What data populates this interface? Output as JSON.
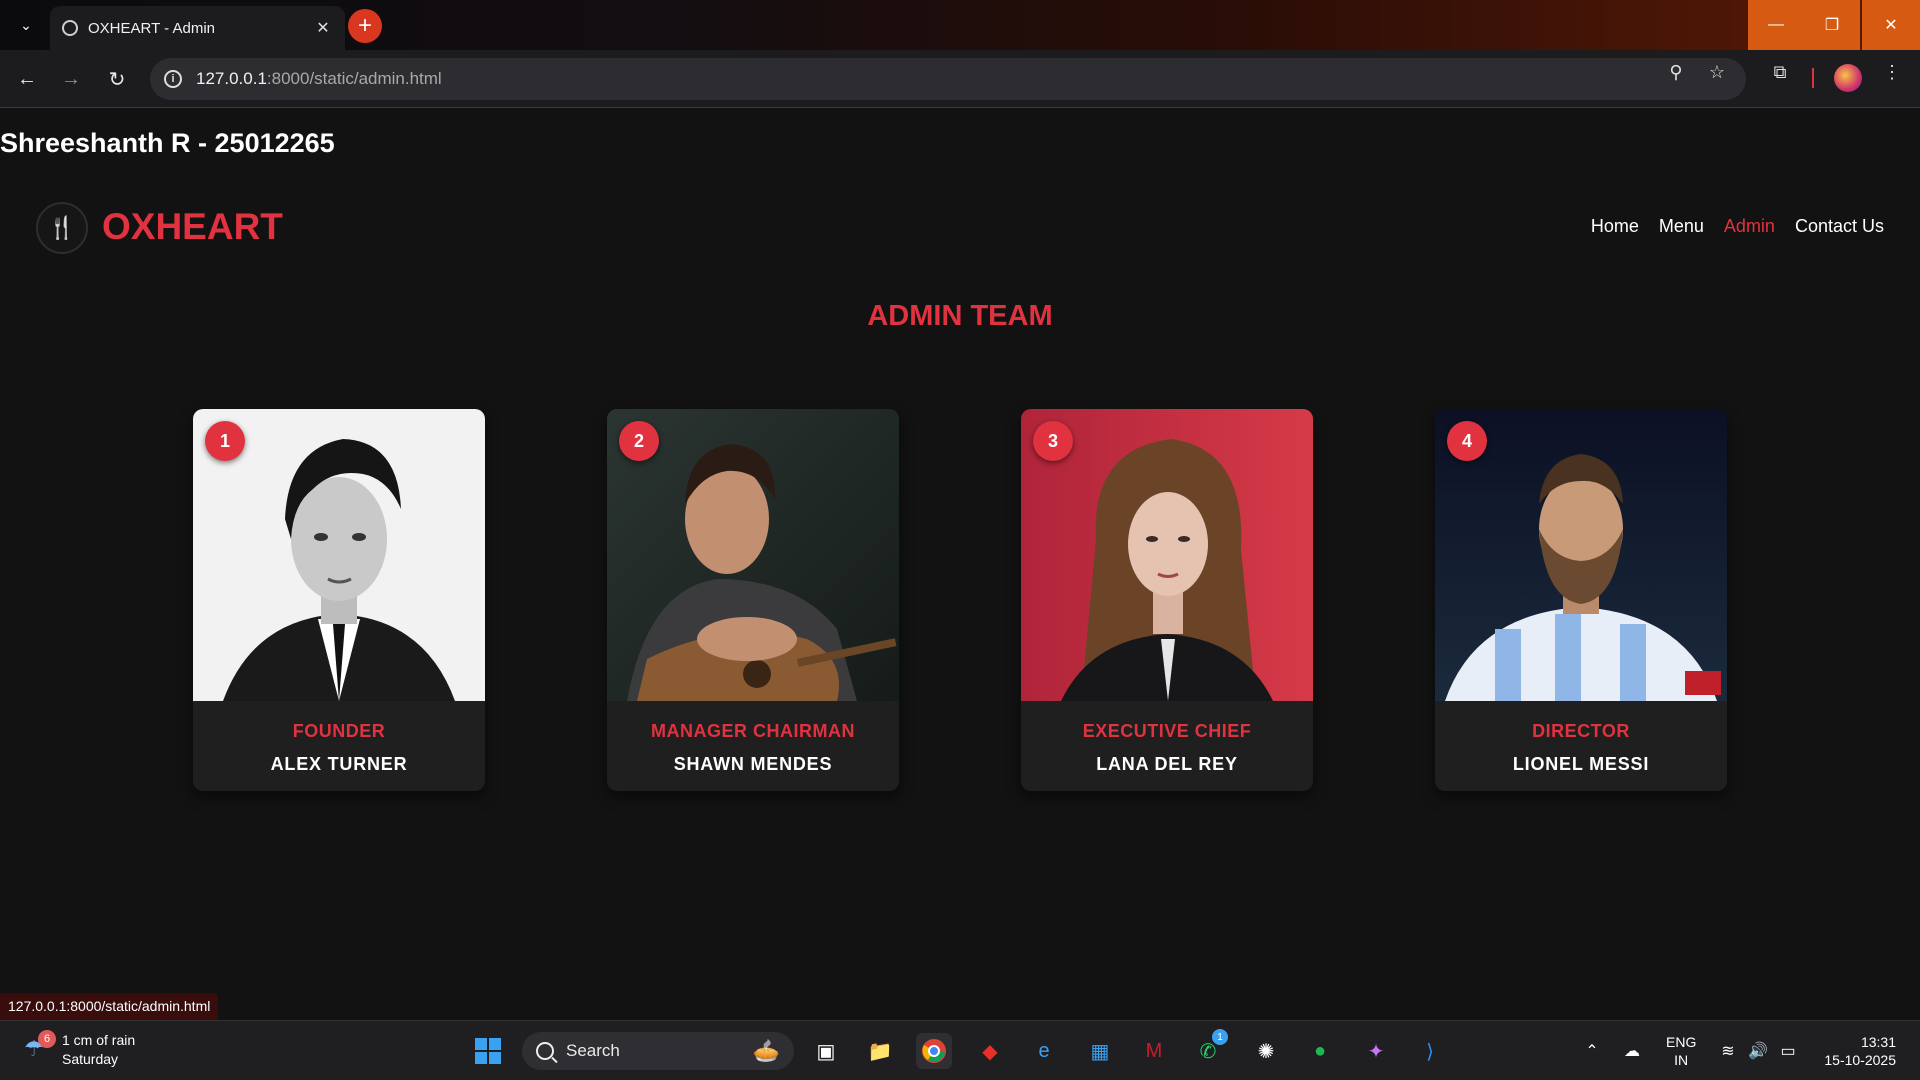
{
  "browser": {
    "tab_title": "OXHEART - Admin",
    "url_host": "127.0.0.1",
    "url_path": ":8000/static/admin.html",
    "status_url": "127.0.0.1:8000/static/admin.html"
  },
  "page": {
    "student_line": "Shreeshanth R - 25012265",
    "brand": "OXHEART",
    "nav": [
      {
        "label": "Home",
        "active": false
      },
      {
        "label": "Menu",
        "active": false
      },
      {
        "label": "Admin",
        "active": true
      },
      {
        "label": "Contact Us",
        "active": false
      }
    ],
    "section_title": "ADMIN TEAM",
    "team": [
      {
        "number": "1",
        "role": "FOUNDER",
        "name": "ALEX TURNER"
      },
      {
        "number": "2",
        "role": "MANAGER CHAIRMAN",
        "name": "SHAWN MENDES"
      },
      {
        "number": "3",
        "role": "EXECUTIVE CHIEF",
        "name": "LANA DEL REY"
      },
      {
        "number": "4",
        "role": "DIRECTOR",
        "name": "LIONEL MESSI"
      }
    ]
  },
  "taskbar": {
    "weather_badge": "6",
    "weather_line1": "1 cm of rain",
    "weather_line2": "Saturday",
    "search_label": "Search",
    "whatsapp_badge": "1",
    "lang_line1": "ENG",
    "lang_line2": "IN",
    "time": "13:31",
    "date": "15-10-2025"
  },
  "colors": {
    "accent": "#e0323f",
    "background": "#121212",
    "card": "#1f1f1f"
  }
}
